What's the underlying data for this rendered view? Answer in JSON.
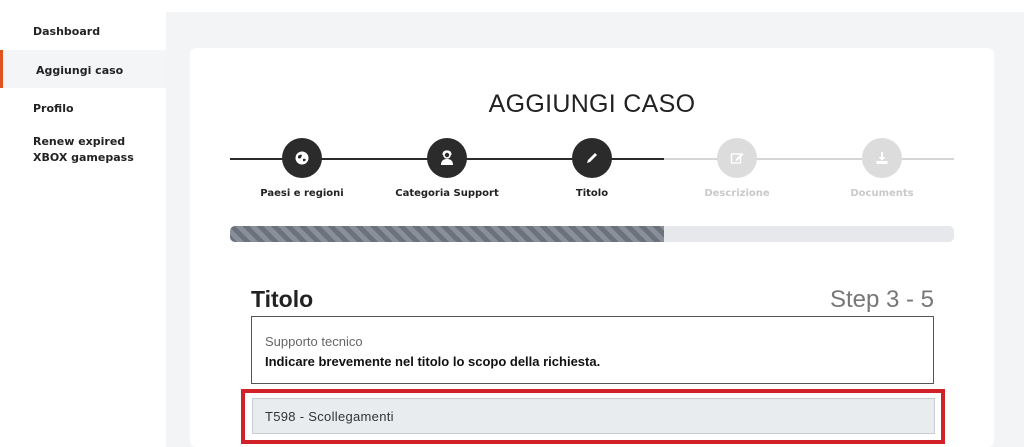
{
  "sidebar": {
    "items": [
      {
        "label": "Dashboard"
      },
      {
        "label": "Aggiungi caso"
      },
      {
        "label": "Profilo"
      },
      {
        "label": "Renew expired XBOX gamepass"
      }
    ]
  },
  "page": {
    "title": "AGGIUNGI CASO"
  },
  "wizard": {
    "steps": [
      {
        "label": "Paesi e regioni",
        "icon": "globe-icon",
        "state": "done"
      },
      {
        "label": "Categoria Support",
        "icon": "support-agent-icon",
        "state": "done"
      },
      {
        "label": "Titolo",
        "icon": "pencil-icon",
        "state": "current"
      },
      {
        "label": "Descrizione",
        "icon": "edit-icon",
        "state": "todo"
      },
      {
        "label": "Documents",
        "icon": "download-icon",
        "state": "todo"
      }
    ],
    "progress": 0.6
  },
  "section": {
    "title": "Titolo",
    "step_counter": "Step 3 - 5",
    "category": "Supporto tecnico",
    "hint": "Indicare brevemente nel titolo lo scopo della richiesta."
  },
  "title_field": {
    "value": "T598 - Scollegamenti"
  },
  "colors": {
    "accent": "#e0521e",
    "highlight": "#d1222a",
    "step_done": "#2b2b2b",
    "step_todo": "#dcdcdc"
  }
}
